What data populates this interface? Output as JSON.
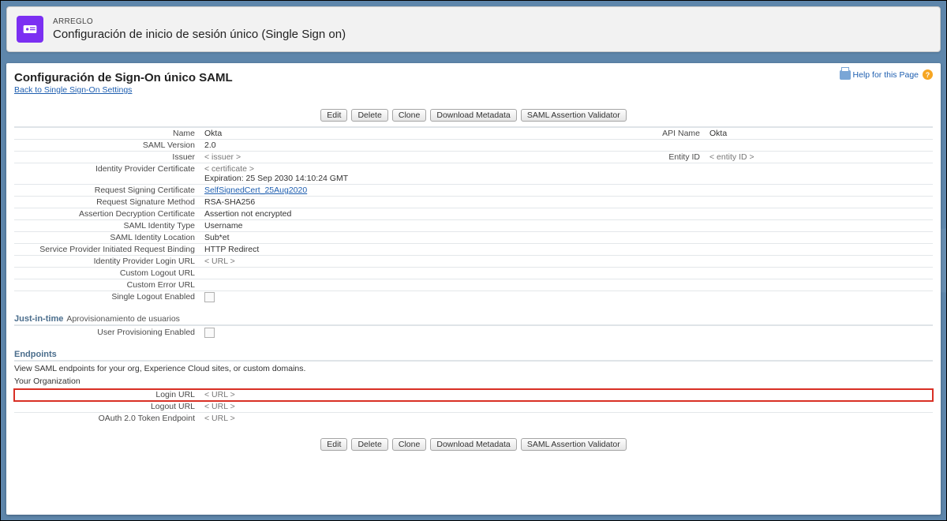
{
  "banner": {
    "kicker": "ARREGLO",
    "title": "Configuración de inicio de sesión único (Single Sign on)"
  },
  "page": {
    "title": "Configuración de Sign-On único SAML",
    "backlink": "Back to Single Sign-On Settings",
    "help": "Help for this Page"
  },
  "buttons": {
    "edit": "Edit",
    "delete": "Delete",
    "clone": "Clone",
    "download": "Download Metadata",
    "validator": "SAML Assertion Validator"
  },
  "fields": {
    "name": {
      "label": "Name",
      "value": "Okta"
    },
    "api_name": {
      "label": "API Name",
      "value": "Okta"
    },
    "saml_version": {
      "label": "SAML Version",
      "value": "2.0"
    },
    "issuer": {
      "label": "Issuer",
      "value": "< issuer >"
    },
    "entity_id": {
      "label": "Entity ID",
      "value": "< entity ID >"
    },
    "idp_cert": {
      "label": "Identity Provider Certificate",
      "value": "< certificate >",
      "exp": "Expiration: 25 Sep 2030 14:10:24 GMT"
    },
    "req_sign_cert": {
      "label": "Request Signing Certificate",
      "value": "SelfSignedCert_25Aug2020"
    },
    "req_sig_method": {
      "label": "Request Signature Method",
      "value": "RSA-SHA256"
    },
    "assert_decrypt": {
      "label": "Assertion Decryption Certificate",
      "value": "Assertion not encrypted"
    },
    "saml_id_type": {
      "label": "SAML Identity Type",
      "value": "Username"
    },
    "saml_id_loc": {
      "label": "SAML Identity Location",
      "value": "Sub*et"
    },
    "sp_binding": {
      "label": "Service Provider Initiated Request Binding",
      "value": "HTTP Redirect"
    },
    "idp_login": {
      "label": "Identity Provider Login URL",
      "value": "< URL >"
    },
    "custom_logout": {
      "label": "Custom Logout URL",
      "value": ""
    },
    "custom_error": {
      "label": "Custom Error URL",
      "value": ""
    },
    "slo": {
      "label": "Single Logout Enabled"
    }
  },
  "jit": {
    "heading": "Just-in-time",
    "sub": "Aprovisionamiento de usuarios",
    "user_prov": {
      "label": "User Provisioning Enabled"
    }
  },
  "endpoints": {
    "heading": "Endpoints",
    "note": "View SAML endpoints for your org, Experience Cloud sites, or custom domains.",
    "org": "Your Organization",
    "login": {
      "label": "Login URL",
      "value": "< URL >"
    },
    "logout": {
      "label": "Logout URL",
      "value": "< URL >"
    },
    "oauth": {
      "label": "OAuth 2.0 Token Endpoint",
      "value": "< URL >"
    }
  }
}
